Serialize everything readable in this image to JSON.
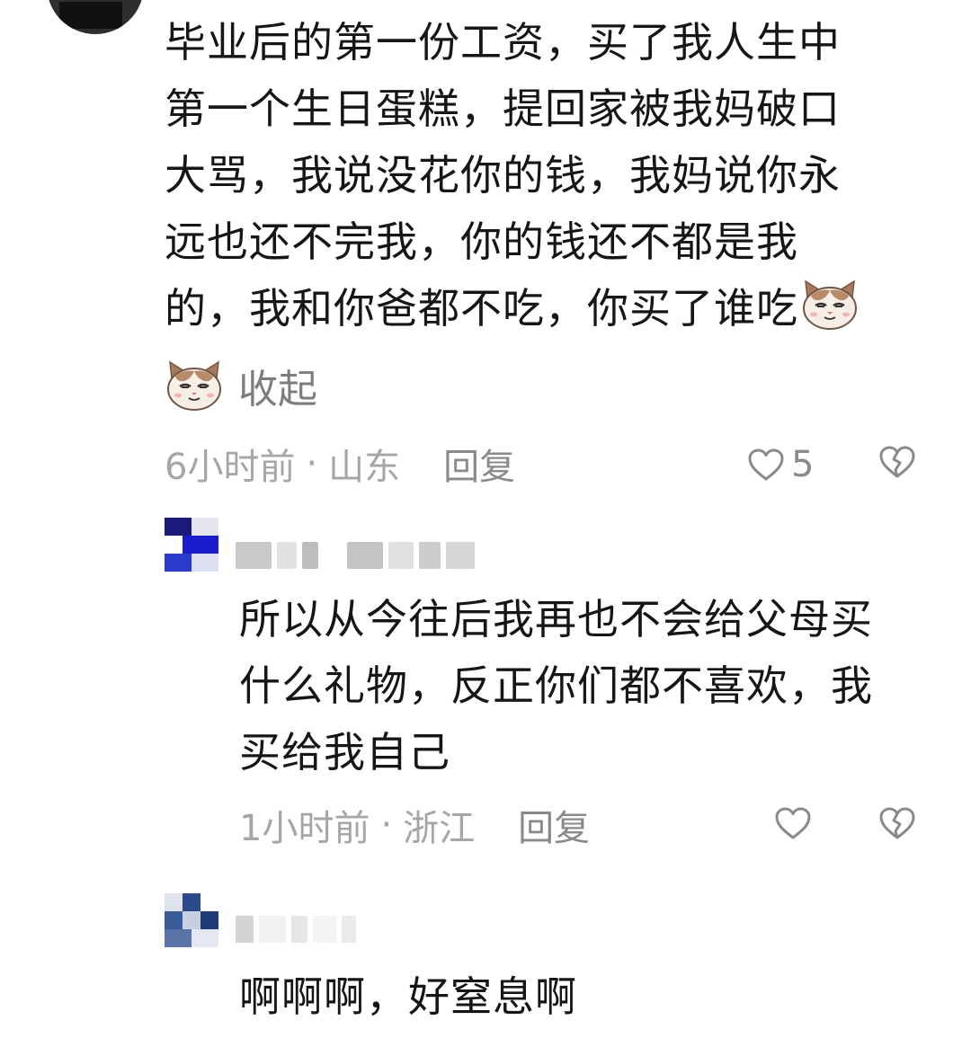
{
  "main_comment": {
    "lines": [
      "毕业后的第一份工资，买了我人生中",
      "第一个生日蛋糕，提回家被我妈破口",
      "大骂，我说没花你的钱，我妈说你永",
      "远也还不完我，你的钱还不都是我",
      "的，我和你爸都不吃，你买了谁吃"
    ],
    "emoji": "cat-face-emoji",
    "collapse_label": "收起",
    "time": "6小时前",
    "separator": "·",
    "location": "山东",
    "reply_label": "回复",
    "like_count": "5"
  },
  "replies": [
    {
      "lines": [
        "所以从今往后我再也不会给父母买",
        "什么礼物，反正你们都不喜欢，我",
        "买给我自己"
      ],
      "time": "1小时前",
      "separator": "·",
      "location": "浙江",
      "reply_label": "回复"
    },
    {
      "lines": [
        "啊啊啊，好窒息啊"
      ]
    }
  ],
  "colors": {
    "text": "#161616",
    "meta": "#a6a6a6",
    "action": "#8a8a8a"
  },
  "icons": [
    "heart-outline-icon",
    "broken-heart-icon",
    "cat-face-emoji"
  ]
}
